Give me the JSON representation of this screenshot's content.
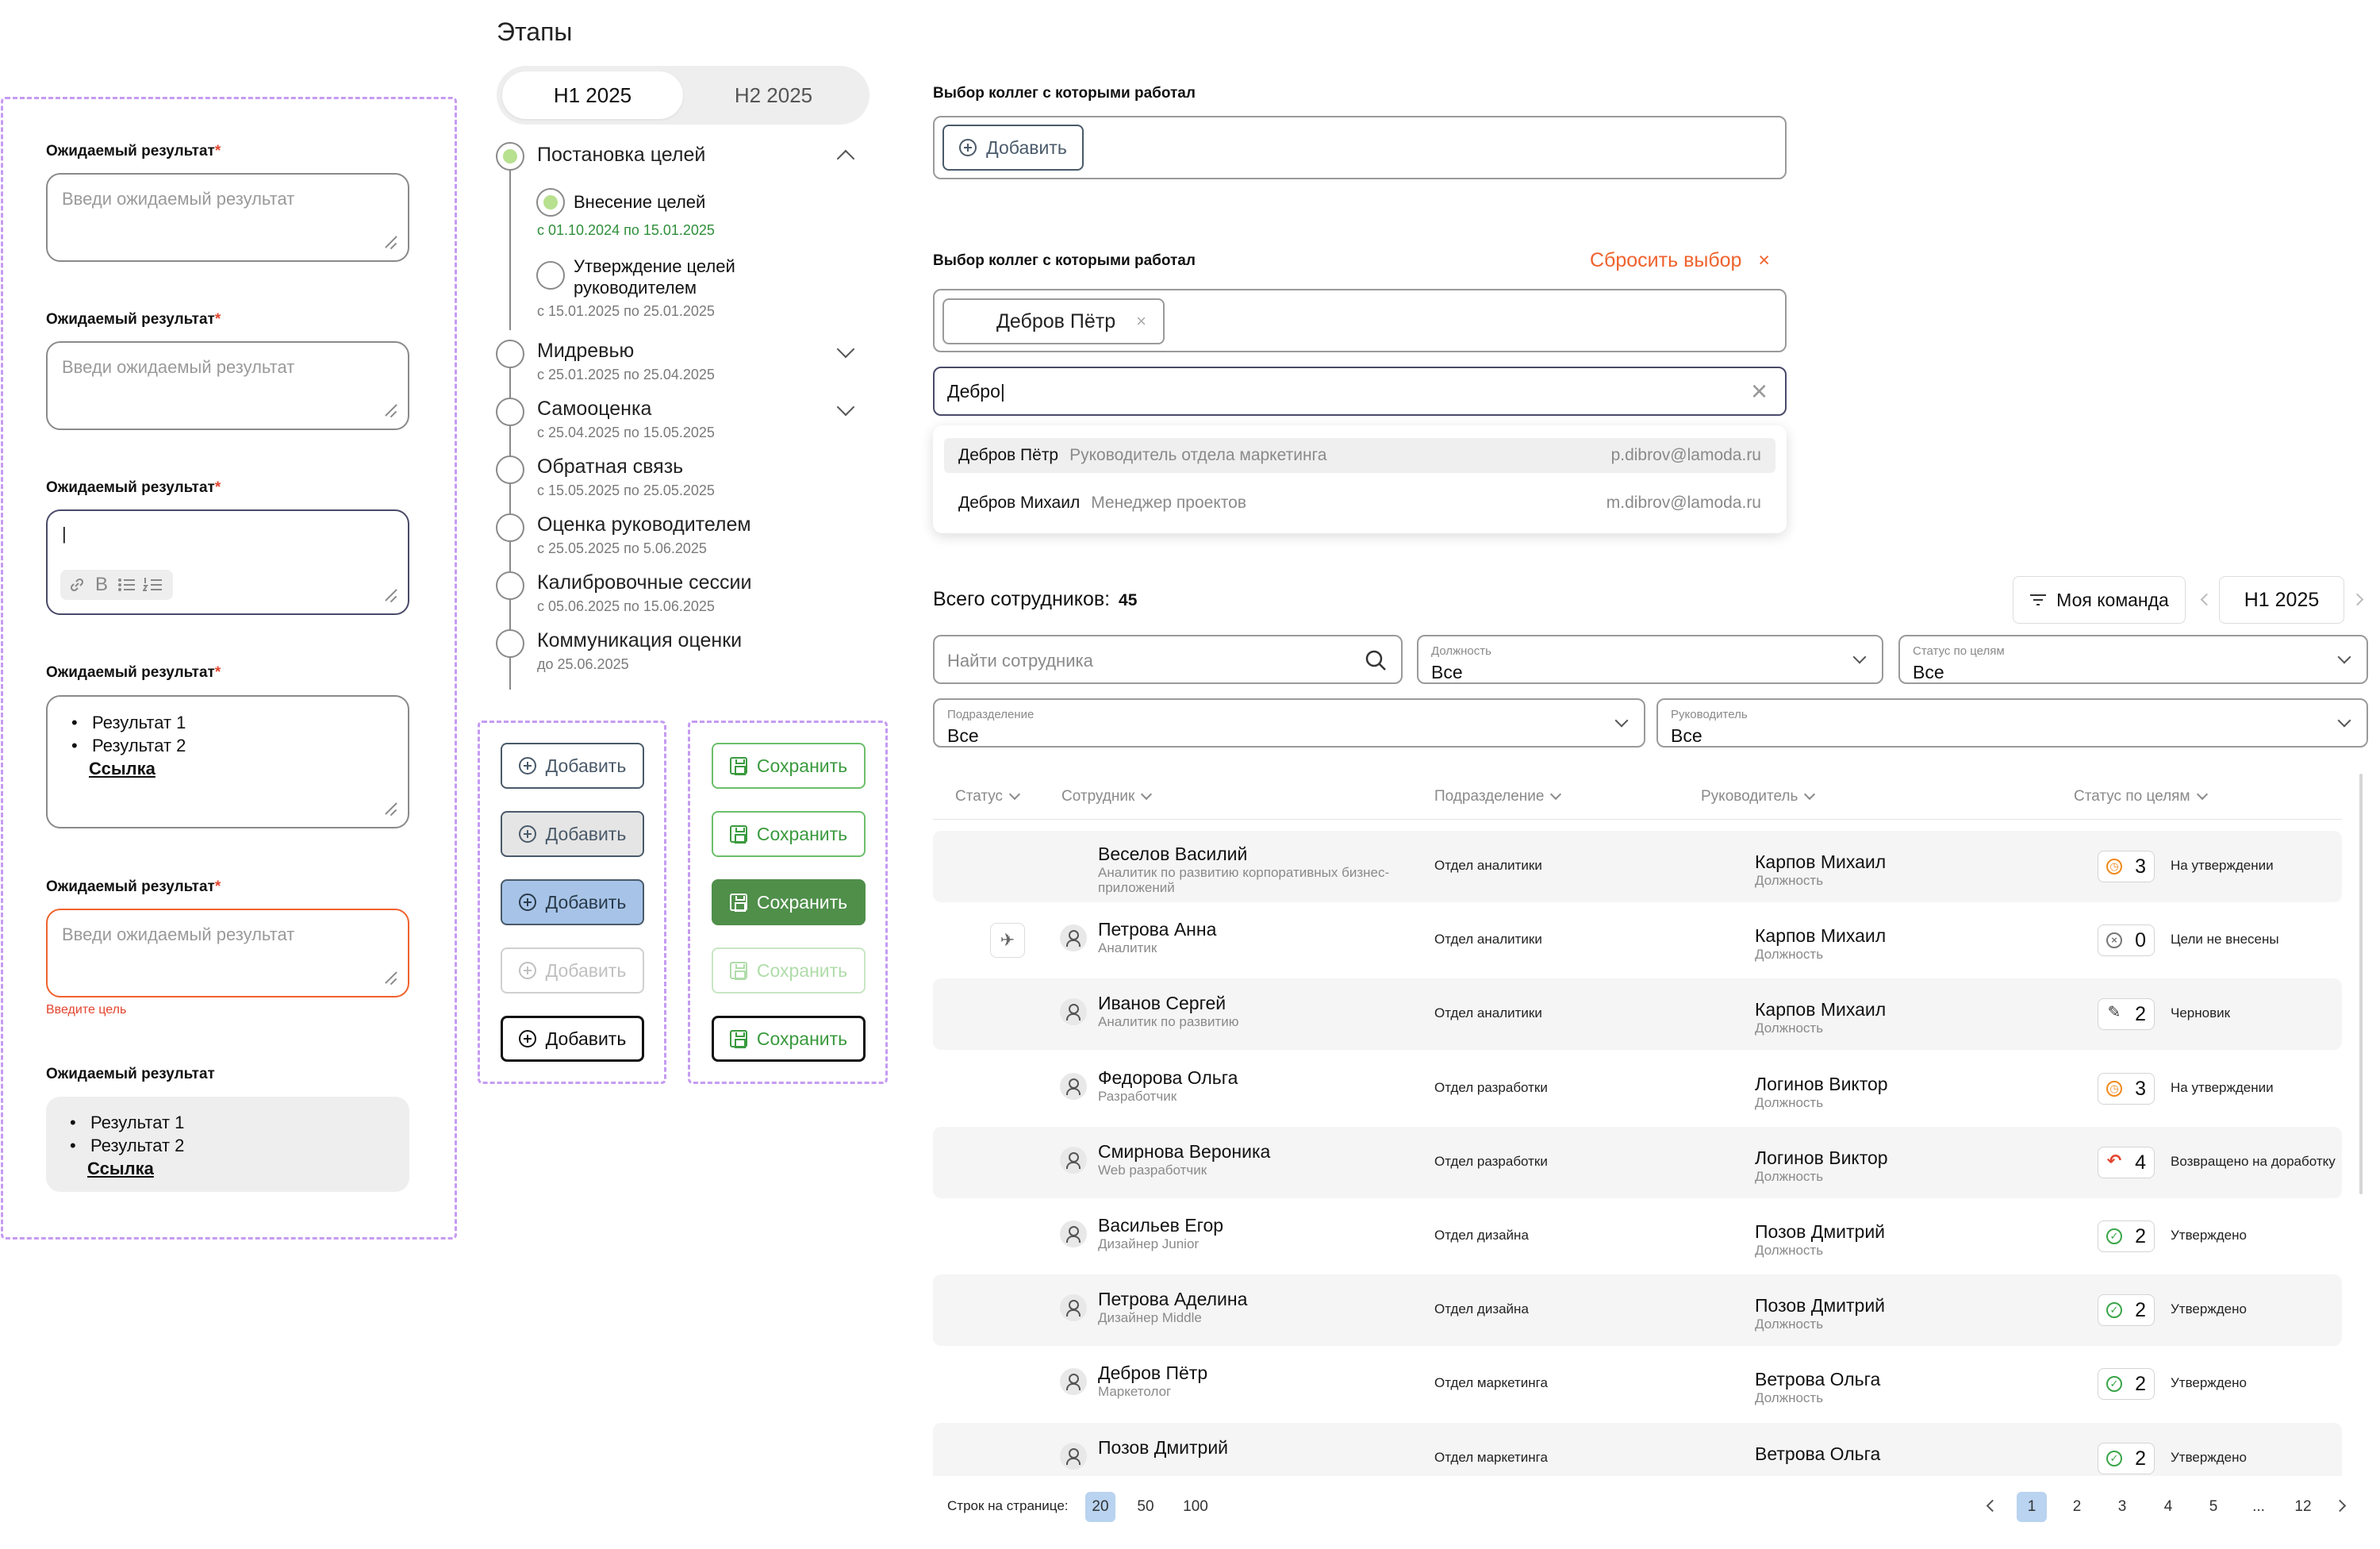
{
  "form": {
    "fields": [
      {
        "label": "Ожидаемый результат",
        "required": "*",
        "placeholder": "Введи ожидаемый результат"
      },
      {
        "label": "Ожидаемый результат",
        "required": "*",
        "placeholder": "Введи ожидаемый результат"
      },
      {
        "label": "Ожидаемый результат",
        "required": "*",
        "cursor": "|"
      },
      {
        "label": "Ожидаемый результат",
        "required": "*",
        "items": [
          "Результат 1",
          "Результат 2"
        ],
        "link": "Ссылка"
      },
      {
        "label": "Ожидаемый результат",
        "required": "*",
        "placeholder": "Введи ожидаемый результат",
        "error": "Введите цель"
      },
      {
        "label": "Ожидаемый результат",
        "items": [
          "Результат 1",
          "Результат 2"
        ],
        "link": "Ссылка"
      }
    ]
  },
  "stages": {
    "title": "Этапы",
    "tabs": [
      "H1 2025",
      "H2 2025"
    ],
    "items": [
      {
        "title": "Постановка целей"
      },
      {
        "title": "Внесение целей",
        "dates": "с 01.10.2024 по 15.01.2025"
      },
      {
        "title": "Утверждение целей руководителем",
        "dates": "с 15.01.2025 по 25.01.2025"
      },
      {
        "title": "Мидревью",
        "dates": "с 25.01.2025 по 25.04.2025"
      },
      {
        "title": "Самооценка",
        "dates": "с 25.04.2025 по 15.05.2025"
      },
      {
        "title": "Обратная связь",
        "dates": "с 15.05.2025 по 25.05.2025"
      },
      {
        "title": "Оценка руководителем",
        "dates": "с 25.05.2025 по 5.06.2025"
      },
      {
        "title": "Калибровочные сессии",
        "dates": "с 05.06.2025 по 15.06.2025"
      },
      {
        "title": "Коммуникация оценки",
        "dates": "до 25.06.2025"
      }
    ]
  },
  "buttons": {
    "add": "Добавить",
    "save": "Сохранить"
  },
  "colleagues": {
    "label": "Выбор коллег с которыми работал",
    "add": "Добавить",
    "reset": "Сбросить выбор",
    "reset_icon": "×",
    "chip": "Дебров Пётр",
    "chip_close": "×",
    "search_value": "Дебро|",
    "clear_icon": "×",
    "options": [
      {
        "name": "Дебров Пётр",
        "role": "Руководитель отдела маркетинга",
        "email": "p.dibrov@lamoda.ru"
      },
      {
        "name": "Дебров Михаил",
        "role": "Менеджер проектов",
        "email": "m.dibrov@lamoda.ru"
      }
    ]
  },
  "employees": {
    "total_label": "Всего сотрудников:",
    "total": "45",
    "my_team": "Моя команда",
    "period": "H1 2025",
    "search_placeholder": "Найти сотрудника",
    "filters": {
      "position": {
        "label": "Должность",
        "value": "Все"
      },
      "goal_status": {
        "label": "Статус по целям",
        "value": "Все"
      },
      "division": {
        "label": "Подразделение",
        "value": "Все"
      },
      "manager": {
        "label": "Руководитель",
        "value": "Все"
      }
    },
    "columns": [
      "Статус",
      "Сотрудник",
      "Подразделение",
      "Руководитель",
      "Статус по целям"
    ],
    "rows": [
      {
        "name": "Веселов Василий",
        "role": "Аналитик по развитию корпоративных бизнес-приложений",
        "dept": "Отдел аналитики",
        "mgr": "Карпов Михаил",
        "mgr_sub": "Должность",
        "count": "3",
        "status": "На утверждении",
        "icon": "clock"
      },
      {
        "name": "Петрова Анна",
        "role": "Аналитик",
        "dept": "Отдел аналитики",
        "mgr": "Карпов Михаил",
        "mgr_sub": "Должность",
        "count": "0",
        "status": "Цели не внесены",
        "icon": "x"
      },
      {
        "name": "Иванов Сергей",
        "role": "Аналитик по развитию",
        "dept": "Отдел аналитики",
        "mgr": "Карпов Михаил",
        "mgr_sub": "Должность",
        "count": "2",
        "status": "Черновик",
        "icon": "pen"
      },
      {
        "name": "Федорова Ольга",
        "role": "Разработчик",
        "dept": "Отдел разработки",
        "mgr": "Логинов Виктор",
        "mgr_sub": "Должность",
        "count": "3",
        "status": "На утверждении",
        "icon": "clock"
      },
      {
        "name": "Смирнова Вероника",
        "role": "Web разработчик",
        "dept": "Отдел разработки",
        "mgr": "Логинов Виктор",
        "mgr_sub": "Должность",
        "count": "4",
        "status": "Возвращено на доработку",
        "icon": "return"
      },
      {
        "name": "Васильев Егор",
        "role": "Дизайнер Junior",
        "dept": "Отдел дизайна",
        "mgr": "Позов Дмитрий",
        "mgr_sub": "Должность",
        "count": "2",
        "status": "Утверждено",
        "icon": "check"
      },
      {
        "name": "Петрова Аделина",
        "role": "Дизайнер Middle",
        "dept": "Отдел дизайна",
        "mgr": "Позов Дмитрий",
        "mgr_sub": "Должность",
        "count": "2",
        "status": "Утверждено",
        "icon": "check"
      },
      {
        "name": "Дебров Пётр",
        "role": "Маркетолог",
        "dept": "Отдел маркетинга",
        "mgr": "Ветрова Ольга",
        "mgr_sub": "Должность",
        "count": "2",
        "status": "Утверждено",
        "icon": "check"
      },
      {
        "name": "Позов Дмитрий",
        "role": "",
        "dept": "Отдел маркетинга",
        "mgr": "Ветрова Ольга",
        "mgr_sub": "",
        "count": "2",
        "status": "Утверждено",
        "icon": "check"
      }
    ],
    "rows_per_page_label": "Строк на странице:",
    "rows_per_page": [
      "20",
      "50",
      "100"
    ],
    "pages": [
      "1",
      "2",
      "3",
      "4",
      "5",
      "...",
      "12"
    ]
  }
}
